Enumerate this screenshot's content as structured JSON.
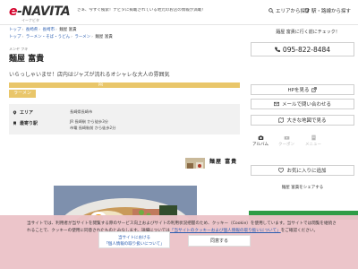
{
  "header": {
    "logo": "e-NAVITA",
    "logo_sub": "イーナビタ",
    "tagline": "さぁ、今すぐ検索！ナビタに掲載されている地元のお店の情報が満載！",
    "nav": [
      {
        "label": "エリアから探す",
        "icon": "search-icon"
      },
      {
        "label": "駅・路線から探す",
        "icon": "train-icon"
      }
    ]
  },
  "breadcrumbs": [
    [
      "トップ",
      "長崎県",
      "長崎市",
      "麺屋 富貴"
    ],
    [
      "トップ",
      "ラーメン・そば・うどん",
      "ラーメン",
      "麺屋 富貴"
    ]
  ],
  "shop": {
    "furigana": "メンヤ フキ",
    "name": "麺屋 富貴",
    "intro": "いらっしゃいませ！店内はジャズが流れるオシャレな大人の雰囲気",
    "pr_label": "PR",
    "genre": "ラーメン",
    "area_label": "エリア",
    "area_value": "長崎県長崎市",
    "station_label": "最寄り駅",
    "station_lines": [
      "JR 長崎駅 から徒歩3分",
      "市電 長崎駅前 から徒歩2分"
    ],
    "sign_text": "麺屋 富貴",
    "features": [
      {
        "label": "アルバム",
        "icon": "camera-icon",
        "enabled": true
      },
      {
        "label": "クーポン",
        "icon": "coupon-icon",
        "enabled": false
      },
      {
        "label": "メニュー",
        "icon": "menu-icon",
        "enabled": false
      }
    ]
  },
  "side": {
    "title": "麺屋 富貴に行く前にチェック！",
    "phone": "095-822-8484",
    "hp_label": "HPを見る",
    "mail_label": "メールで問い合わせる",
    "map_label": "大きな地図で見る",
    "fav_label": "お気に入りに追加",
    "share_title": "麺屋 富貴をシェアする"
  },
  "cookie": {
    "text_1": "当サイトでは、利用者が当サイトを閲覧する際のサービス向上およびサイトの利用状況把握のため、クッキー（Cookie）を使用しています。当サイトでは閲覧を継続されることで、クッキーの使用に同意されたものとみなします。詳細については",
    "link_text": "「当サイトのクッキーおよび個人情報の取り扱いについて」",
    "text_2": "をご確認ください。",
    "link_btn_line1": "当サイトにおける",
    "link_btn_line2": "「個人情報の取り扱いについて」",
    "agree_label": "同意する"
  },
  "colors": {
    "brand_red": "#d4002a",
    "pr_yellow": "#e9c66a",
    "link_blue": "#2a5db0",
    "share_green": "#2e9c46",
    "cookie_pink": "#ebc3c8"
  }
}
